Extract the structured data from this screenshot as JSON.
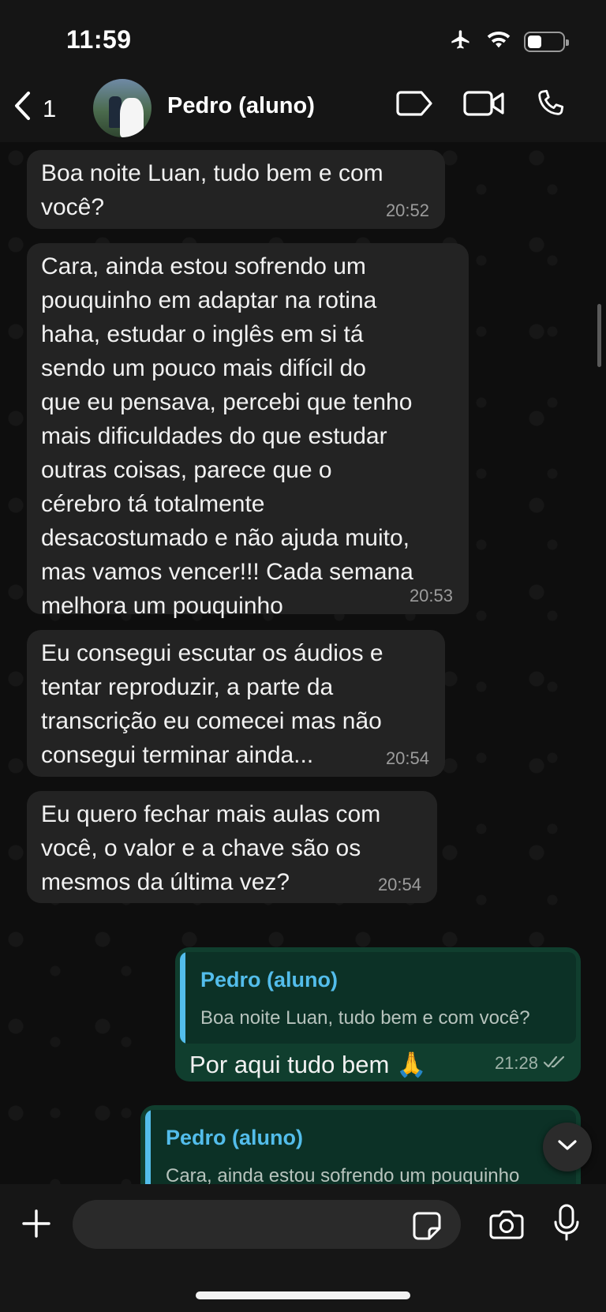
{
  "status": {
    "time": "11:59",
    "battery_level": 0.4
  },
  "header": {
    "back_count": "1",
    "contact_name": "Pedro (aluno)"
  },
  "messages": [
    {
      "text": "Boa noite Luan, tudo bem e com\nvocê?",
      "time": "20:52"
    },
    {
      "text": "Cara, ainda estou sofrendo um\npouquinho em adaptar na rotina\nhaha, estudar o inglês em si tá\nsendo um pouco mais difícil do\nque eu pensava, percebi que tenho\nmais dificuldades do que estudar\noutras coisas, parece que o\ncérebro tá totalmente\ndesacostumado e não ajuda muito,\nmas vamos vencer!!! Cada semana\nmelhora um pouquinho",
      "time": "20:53"
    },
    {
      "text": "Eu consegui escutar os áudios e\ntentar reproduzir, a parte da\ntranscrição eu comecei mas não\nconsegui terminar ainda...",
      "time": "20:54"
    },
    {
      "text": "Eu quero fechar mais aulas com\nvocê, o valor e a chave são os\nmesmos da última vez?",
      "time": "20:54"
    }
  ],
  "replies": [
    {
      "quote_name": "Pedro (aluno)",
      "quote_text": "Boa noite Luan, tudo bem e com você?",
      "text": "Por aqui tudo bem 🙏",
      "time": "21:28"
    },
    {
      "quote_name": "Pedro (aluno)",
      "quote_text": "Cara, ainda estou sofrendo um pouquinho"
    }
  ],
  "colors": {
    "incoming_bubble": "#232323",
    "outgoing_bubble": "#103e2e",
    "quote_accent": "#53bdeb"
  },
  "icons": [
    "airplane-icon",
    "wifi-icon",
    "battery-icon",
    "back-chevron-icon",
    "label-icon",
    "video-call-icon",
    "phone-icon",
    "chevron-down-icon",
    "plus-icon",
    "sticker-icon",
    "camera-icon",
    "mic-icon"
  ]
}
